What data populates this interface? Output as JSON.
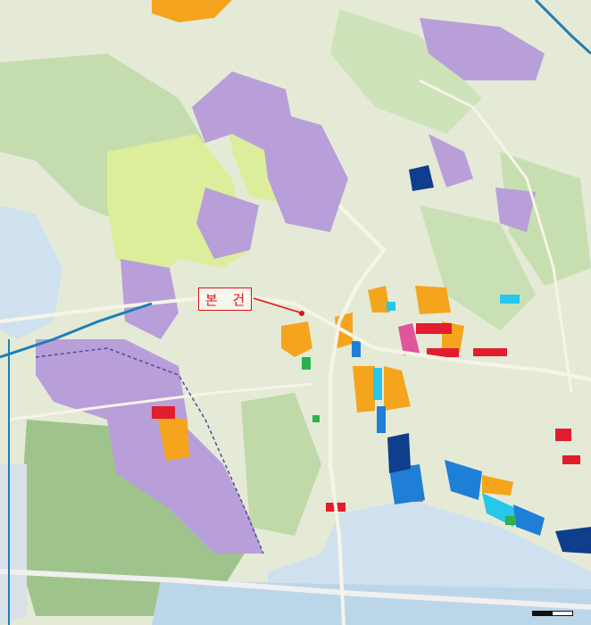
{
  "map": {
    "target_label": "본 건",
    "colors": {
      "water": "#cfe1ee",
      "forest": "#c5dcae",
      "residential": "#b89fd9",
      "orange": "#f5a51d",
      "red": "#e11d2e",
      "blue": "#1f7fd6",
      "cyan": "#28c6ea",
      "navy": "#0f3e8c",
      "pink": "#e0569b",
      "green": "#2bb24c",
      "yellowgreen": "#dcee9c"
    }
  }
}
